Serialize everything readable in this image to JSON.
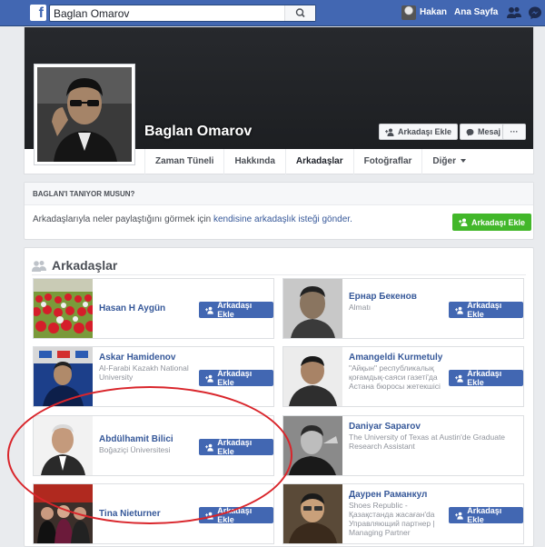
{
  "topbar": {
    "logo": "f",
    "search_value": "Baglan Omarov",
    "user": "Hakan",
    "home": "Ana Sayfa"
  },
  "profile": {
    "name": "Baglan Omarov",
    "add_friend": "Arkadaşı Ekle",
    "message": "Mesaj",
    "more": "···",
    "tabs": [
      {
        "label": "Zaman Tüneli"
      },
      {
        "label": "Hakkında"
      },
      {
        "label": "Arkadaşlar"
      },
      {
        "label": "Fotoğraflar"
      },
      {
        "label": "Diğer"
      }
    ]
  },
  "know": {
    "title": "BAGLAN'I TANIYOR MUSUN?",
    "text": "Arkadaşlarıyla neler paylaştığını görmek için",
    "link": "kendisine arkadaşlık isteği gönder.",
    "button": "Arkadaşı Ekle"
  },
  "friends": {
    "title": "Arkadaşlar",
    "add_label": "Arkadaşı Ekle",
    "items": [
      {
        "name": "Hasan H Aygün",
        "sub": ""
      },
      {
        "name": "Ернар Бекенов",
        "sub": "Almatı"
      },
      {
        "name": "Askar Hamidenov",
        "sub": "Al-Farabi Kazakh National University"
      },
      {
        "name": "Amangeldi Kurmetuly",
        "sub": "\"Айқын\" республикалық қоғамдық-саяси газеті'да Астана бюросы жетекшісі"
      },
      {
        "name": "Abdülhamit Bilici",
        "sub": "Boğaziçi Üniversitesi"
      },
      {
        "name": "Daniyar Saparov",
        "sub": "The University of Texas at Austin'de Graduate Research Assistant"
      },
      {
        "name": "Tina Nieturner",
        "sub": ""
      },
      {
        "name": "Даурен Раманкул",
        "sub": "Shoes Republic - Қазақстанда жасаған'da Управляющий партнер | Managing Partner"
      }
    ]
  }
}
